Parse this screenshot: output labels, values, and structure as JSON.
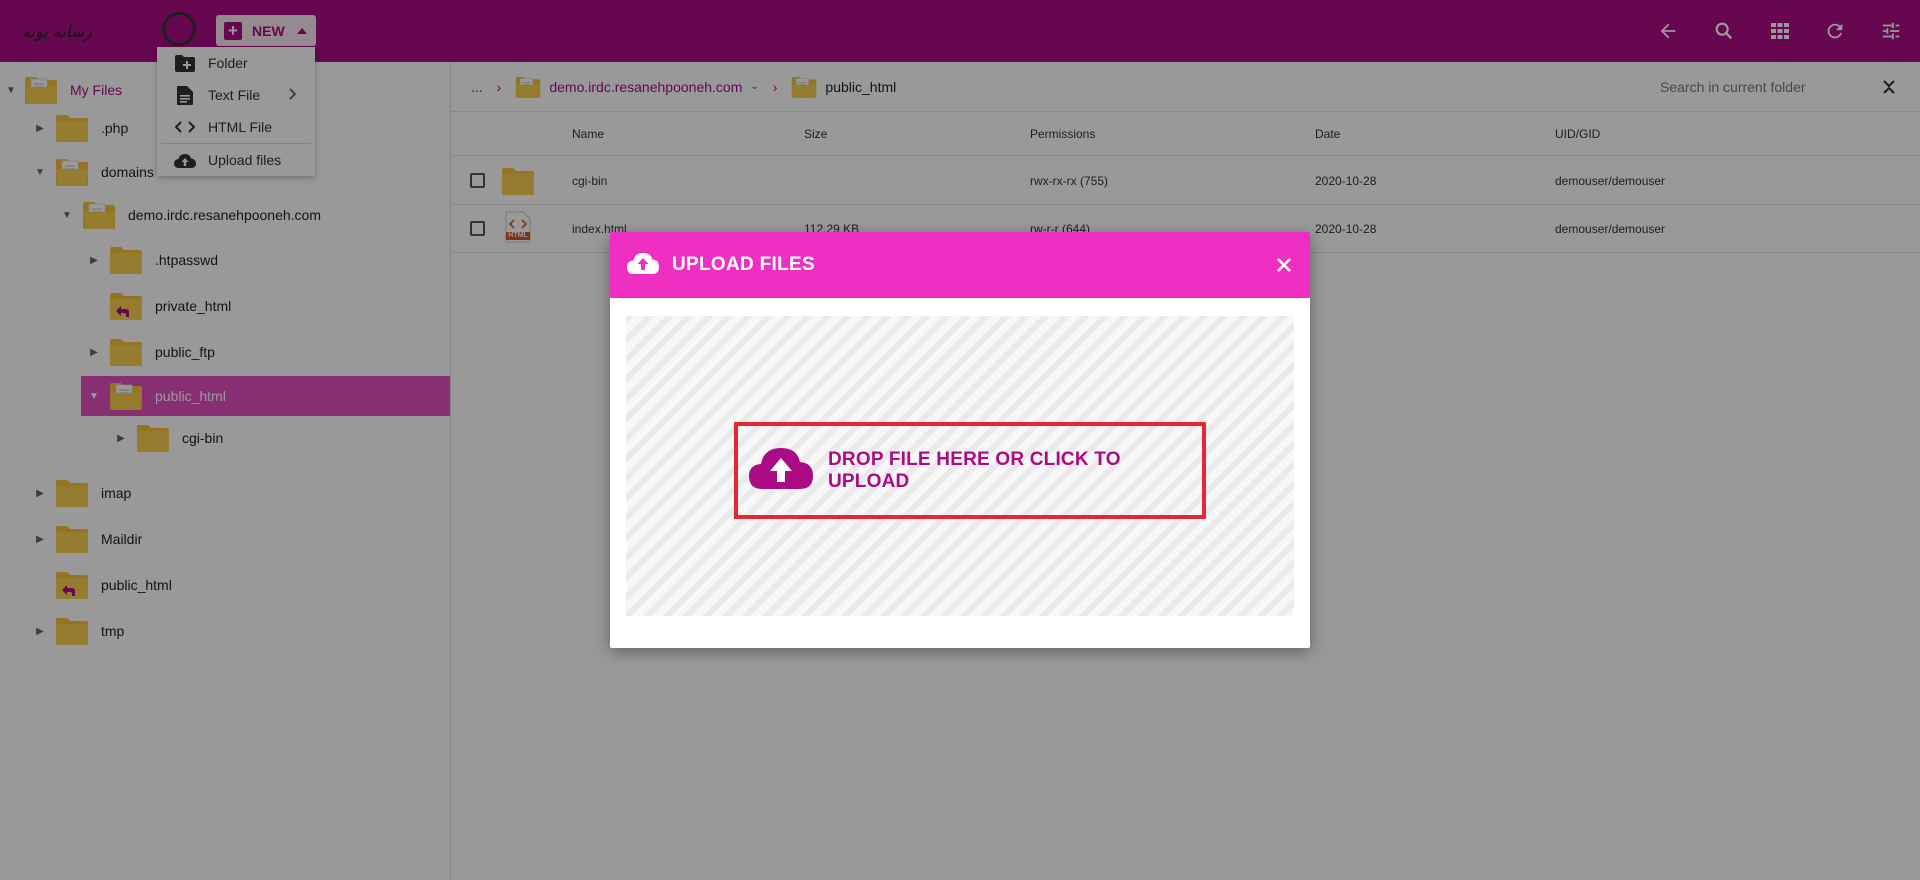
{
  "topbar": {
    "new_label": "NEW",
    "logo_word": "رسانه پونه"
  },
  "new_menu": {
    "items": [
      {
        "label": "Folder",
        "icon": "new-folder-icon"
      },
      {
        "label": "Text File",
        "icon": "text-file-icon"
      },
      {
        "label": "HTML File",
        "icon": "code-icon"
      },
      {
        "label": "Upload files",
        "icon": "cloud-upload-icon"
      }
    ]
  },
  "tree": {
    "root": "My Files",
    "items": [
      {
        "label": ".php"
      },
      {
        "label": "domains"
      },
      {
        "label": "demo.irdc.resanehpooneh.com"
      },
      {
        "label": ".htpasswd"
      },
      {
        "label": "private_html"
      },
      {
        "label": "public_ftp"
      },
      {
        "label": "public_html"
      },
      {
        "label": "cgi-bin"
      },
      {
        "label": "imap"
      },
      {
        "label": "Maildir"
      },
      {
        "label": "public_html"
      },
      {
        "label": "tmp"
      }
    ]
  },
  "breadcrumb": {
    "ellipsis": "...",
    "domain": "demo.irdc.resanehpooneh.com",
    "current": "public_html"
  },
  "search": {
    "placeholder": "Search in current folder"
  },
  "table": {
    "headers": {
      "name": "Name",
      "size": "Size",
      "permissions": "Permissions",
      "date": "Date",
      "uid": "UID/GID"
    },
    "rows": [
      {
        "name": "cgi-bin",
        "size": "",
        "permissions": "rwx-rx-rx (755)",
        "date": "2020-10-28",
        "uid": "demouser/demouser"
      },
      {
        "name": "index.html",
        "size": "112.29 KB",
        "permissions": "rw-r-r (644)",
        "date": "2020-10-28",
        "uid": "demouser/demouser",
        "badge": "HTML"
      }
    ]
  },
  "modal": {
    "title": "UPLOAD FILES",
    "drop_text": "DROP FILE HERE OR CLICK TO UPLOAD"
  },
  "colors": {
    "brand": "#ab0c86",
    "modal_header": "#ef2fc2",
    "selected_row": "#e14fbe",
    "folder": "#f7c23a",
    "highlight_border": "#e22834"
  }
}
